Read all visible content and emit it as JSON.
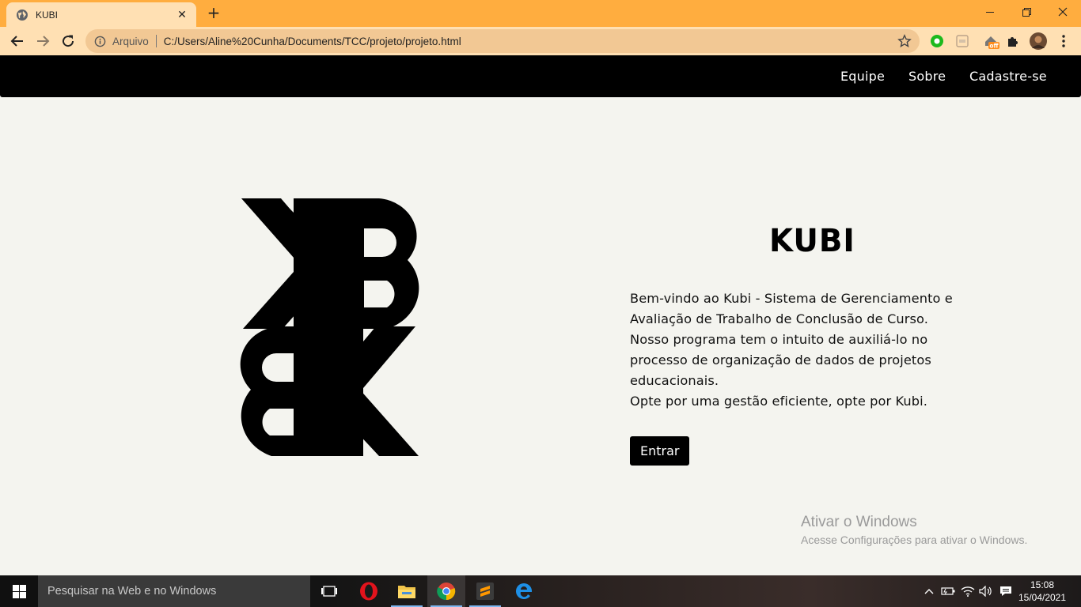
{
  "browser": {
    "tab_title": "KUBI",
    "address_scheme": "Arquivo",
    "address_url": "C:/Users/Aline%20Cunha/Documents/TCC/projeto/projeto.html",
    "extension_badge": "off"
  },
  "site_nav": {
    "items": [
      {
        "label": "Equipe"
      },
      {
        "label": "Sobre"
      },
      {
        "label": "Cadastre-se"
      }
    ]
  },
  "hero": {
    "brand": "KUBI",
    "intro_lines": [
      "Bem-vindo ao Kubi - Sistema de Gerenciamento e",
      "Avaliação de Trabalho de Conclusão de Curso.",
      "Nosso programa tem o intuito de auxiliá-lo no",
      "processo de organização de dados de projetos",
      "educacionais.",
      "Opte por uma gestão eficiente, opte por Kubi."
    ],
    "enter_label": "Entrar"
  },
  "watermark": {
    "title": "Ativar o Windows",
    "subtitle": "Acesse Configurações para ativar o Windows."
  },
  "taskbar": {
    "search_placeholder": "Pesquisar na Web e no Windows",
    "time": "15:08",
    "date": "15/04/2021"
  },
  "colors": {
    "tab_strip": "#ffad3f",
    "toolbar": "#ffe0b3",
    "page_bg": "#f4f4ef",
    "nav_bg": "#000000",
    "accent_button": "#000000"
  }
}
